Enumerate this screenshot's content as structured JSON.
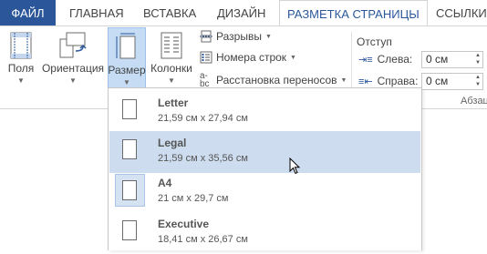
{
  "tabs": {
    "file": "ФАЙЛ",
    "home": "ГЛАВНАЯ",
    "insert": "ВСТАВКА",
    "design": "ДИЗАЙН",
    "layout": "РАЗМЕТКА СТРАНИЦЫ",
    "references": "ССЫЛКИ"
  },
  "ribbon": {
    "margins": "Поля",
    "orientation": "Ориентация",
    "size": "Размер",
    "columns": "Колонки",
    "breaks": "Разрывы",
    "line_numbers": "Номера строк",
    "hyphenation": "Расстановка переносов",
    "indent": {
      "title": "Отступ",
      "left_label": "Слева:",
      "left_value": "0 см",
      "right_label": "Справа:",
      "right_value": "0 см"
    },
    "group_label": "Абзац"
  },
  "sizes": [
    {
      "name": "Letter",
      "dims": "21,59 см x 27,94 см"
    },
    {
      "name": "Legal",
      "dims": "21,59 см x 35,56 см"
    },
    {
      "name": "A4",
      "dims": "21 см x 29,7 см"
    },
    {
      "name": "Executive",
      "dims": "18,41 см x 26,67 см"
    }
  ],
  "colors": {
    "accent": "#2b579a",
    "hover": "#cddcee",
    "selected": "#c5dcf4"
  }
}
